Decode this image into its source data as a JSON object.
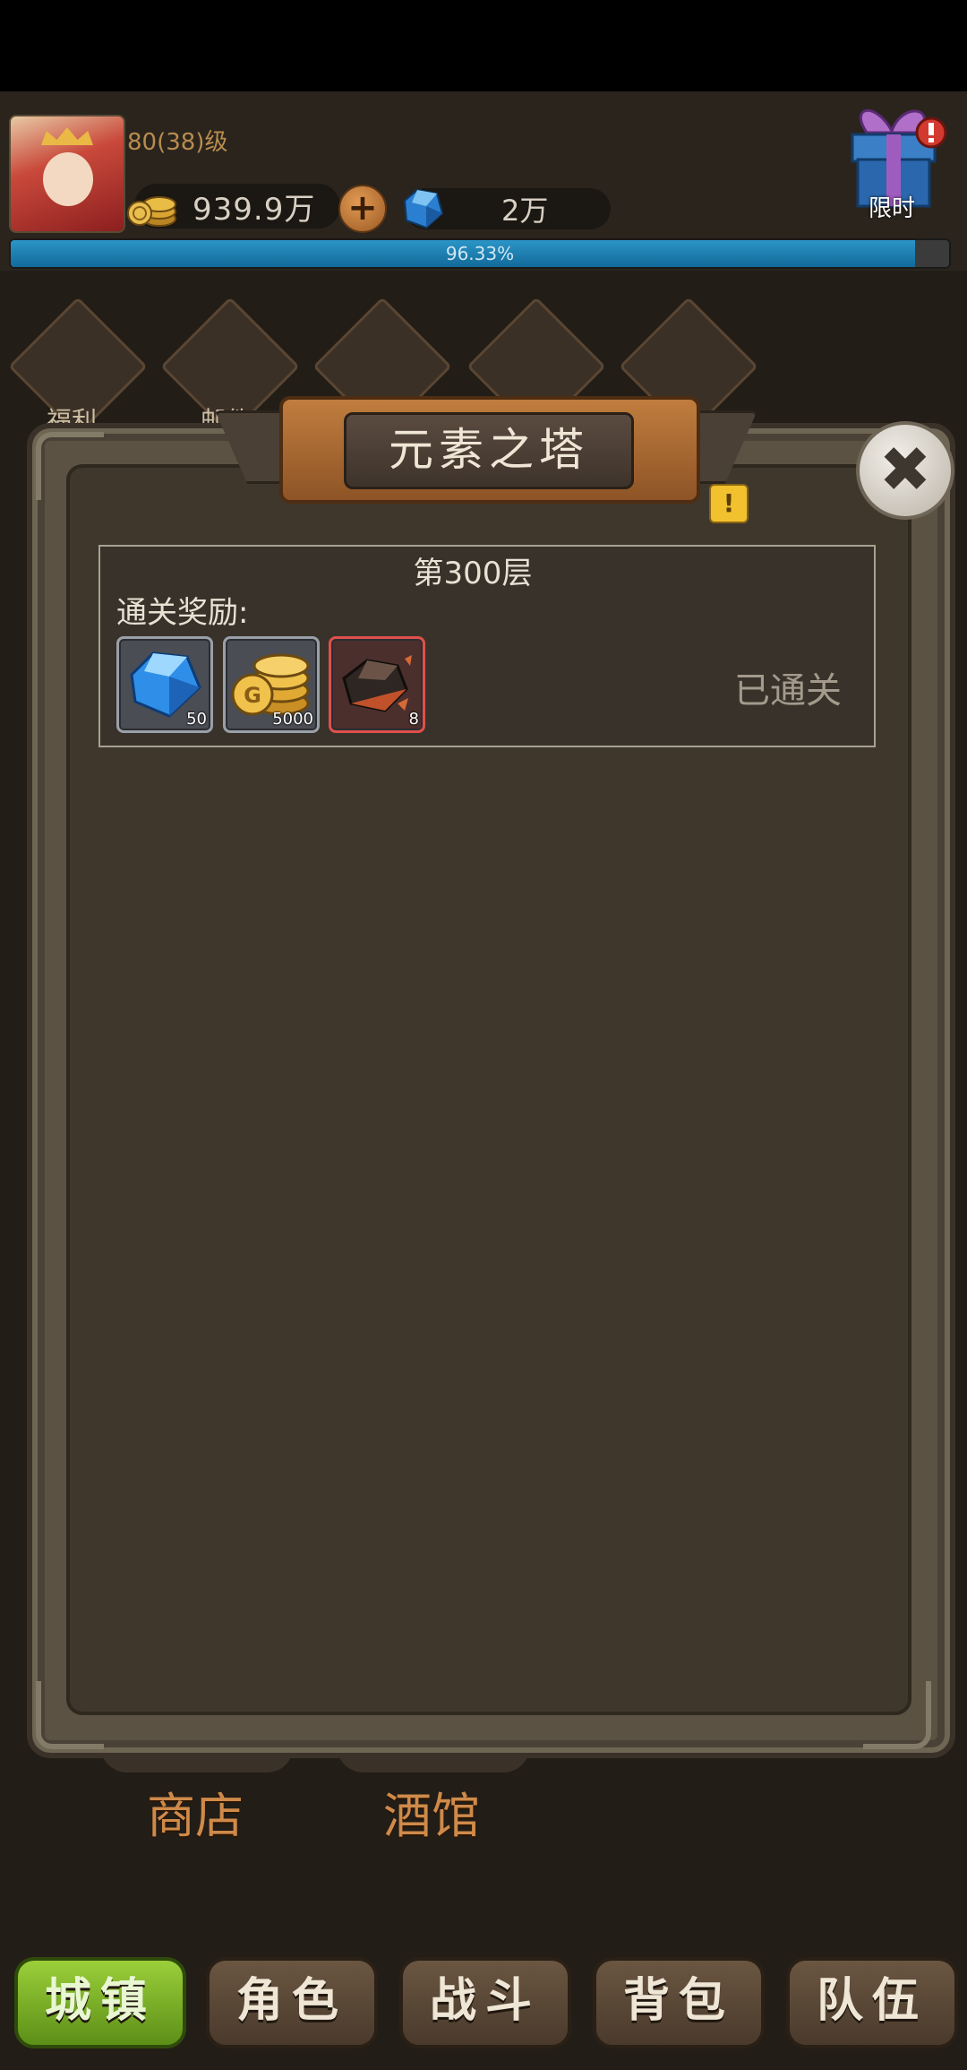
{
  "player": {
    "level_text": "80(38)级",
    "gold": "939.9万",
    "gems": "2万",
    "exp_percent": 96.33,
    "exp_label": "96.33%"
  },
  "limited_event": {
    "label": "限时"
  },
  "background_menu": [
    "福利",
    "邮件"
  ],
  "dialog": {
    "title": "元素之塔",
    "floor_title": "第300层",
    "reward_label": "通关奖励:",
    "status": "已通关",
    "rewards": [
      {
        "icon": "blue-gem-icon",
        "qty": "50"
      },
      {
        "icon": "gold-coins-icon",
        "qty": "5000"
      },
      {
        "icon": "ore-icon",
        "qty": "8"
      }
    ]
  },
  "town": {
    "shop": "商店",
    "tavern": "酒馆"
  },
  "nav": {
    "items": [
      "城镇",
      "角色",
      "战斗",
      "背包",
      "队伍"
    ],
    "active_index": 0
  },
  "colors": {
    "progress": "#2b95c8",
    "active_nav": "#9bcf3a",
    "title_banner": "#c07d3e",
    "rare_border": "#e0504b"
  }
}
